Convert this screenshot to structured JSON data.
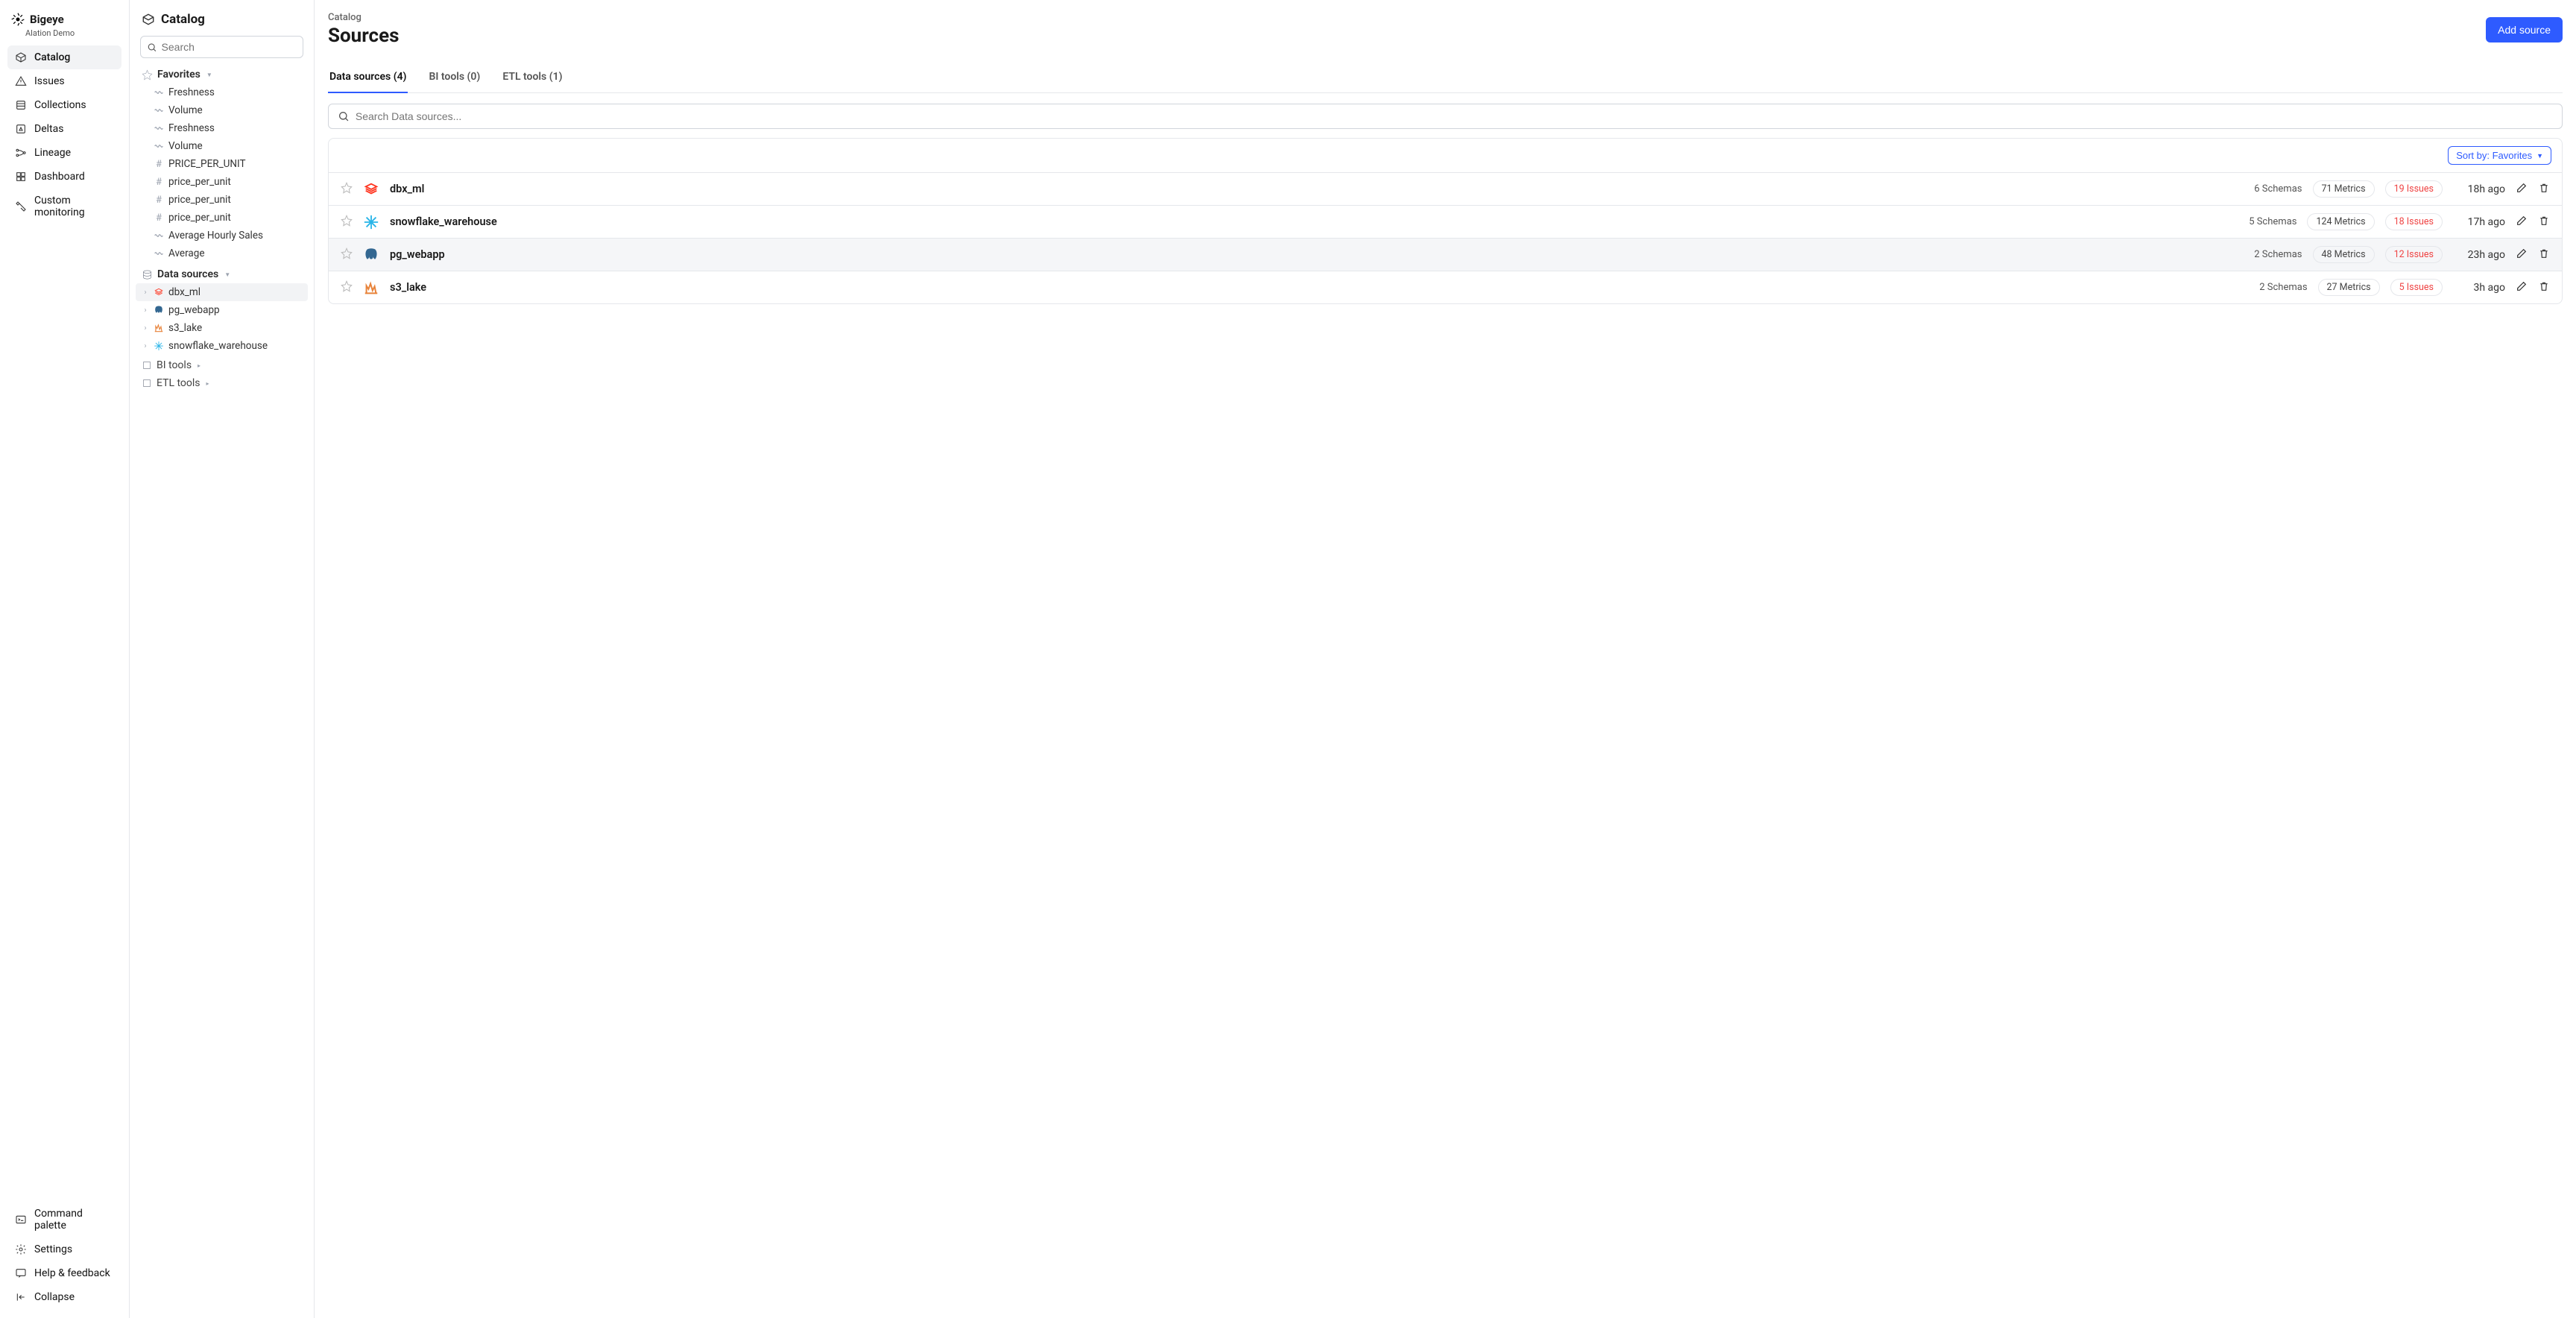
{
  "brand": {
    "name": "Bigeye",
    "sub": "Alation Demo"
  },
  "nav": {
    "items": [
      {
        "label": "Catalog"
      },
      {
        "label": "Issues"
      },
      {
        "label": "Collections"
      },
      {
        "label": "Deltas"
      },
      {
        "label": "Lineage"
      },
      {
        "label": "Dashboard"
      },
      {
        "label": "Custom monitoring"
      }
    ],
    "bottom": [
      {
        "label": "Command palette"
      },
      {
        "label": "Settings"
      },
      {
        "label": "Help & feedback"
      },
      {
        "label": "Collapse"
      }
    ]
  },
  "panel": {
    "title": "Catalog",
    "search_placeholder": "Search",
    "favorites_label": "Favorites",
    "favorites": [
      "Freshness",
      "Volume",
      "Freshness",
      "Volume",
      "PRICE_PER_UNIT",
      "price_per_unit",
      "price_per_unit",
      "price_per_unit",
      "Average Hourly Sales",
      "Average"
    ],
    "data_sources_label": "Data sources",
    "data_sources": [
      "dbx_ml",
      "pg_webapp",
      "s3_lake",
      "snowflake_warehouse"
    ],
    "bi_tools_label": "BI tools",
    "etl_tools_label": "ETL tools"
  },
  "main": {
    "breadcrumb": "Catalog",
    "title": "Sources",
    "add_button": "Add source",
    "tabs": [
      "Data sources (4)",
      "BI tools (0)",
      "ETL tools (1)"
    ],
    "search_placeholder": "Search Data sources...",
    "sort_label": "Sort by: Favorites",
    "rows": [
      {
        "name": "dbx_ml",
        "schemas": "6 Schemas",
        "metrics": "71 Metrics",
        "issues": "19 Issues",
        "time": "18h ago",
        "icon": "databricks"
      },
      {
        "name": "snowflake_warehouse",
        "schemas": "5 Schemas",
        "metrics": "124 Metrics",
        "issues": "18 Issues",
        "time": "17h ago",
        "icon": "snowflake"
      },
      {
        "name": "pg_webapp",
        "schemas": "2 Schemas",
        "metrics": "48 Metrics",
        "issues": "12 Issues",
        "time": "23h ago",
        "icon": "postgres"
      },
      {
        "name": "s3_lake",
        "schemas": "2 Schemas",
        "metrics": "27 Metrics",
        "issues": "5 Issues",
        "time": "3h ago",
        "icon": "s3"
      }
    ]
  }
}
